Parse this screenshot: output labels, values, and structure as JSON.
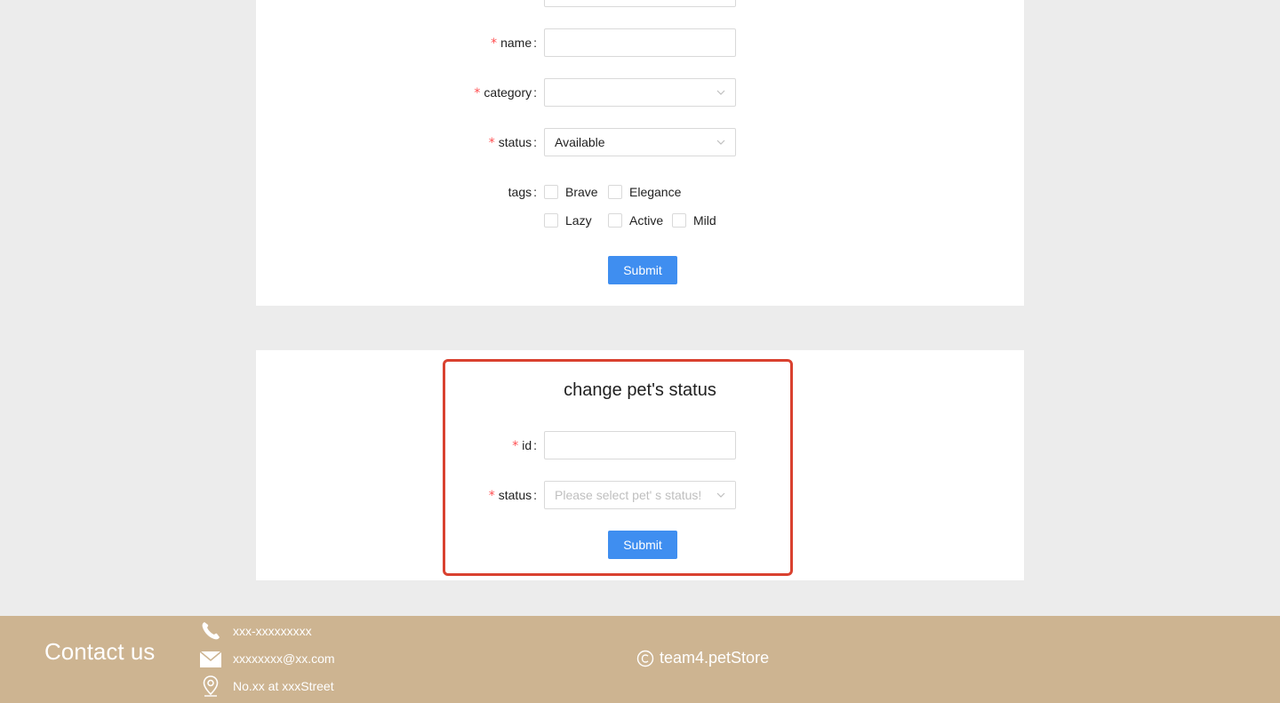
{
  "pet_form": {
    "name": {
      "label": "name",
      "value": ""
    },
    "category": {
      "label": "category",
      "value": ""
    },
    "status": {
      "label": "status",
      "value": "Available"
    },
    "tags": {
      "label": "tags",
      "options": [
        "Brave",
        "Elegance",
        "Lazy",
        "Active",
        "Mild"
      ]
    },
    "submit_label": "Submit"
  },
  "change_status": {
    "title": "change pet's status",
    "id": {
      "label": "id",
      "value": ""
    },
    "status": {
      "label": "status",
      "placeholder": "Please select pet' s status!"
    },
    "submit_label": "Submit"
  },
  "footer": {
    "contact_title": "Contact us",
    "phone": "xxx-xxxxxxxxx",
    "email": "xxxxxxxx@xx.com",
    "address": "No.xx at xxxStreet",
    "copyright": "team4.petStore"
  },
  "colors": {
    "primary": "#3f8ef0",
    "required": "#ff4d4f",
    "footer_bg": "#cdb491",
    "highlight": "#d9412f"
  }
}
